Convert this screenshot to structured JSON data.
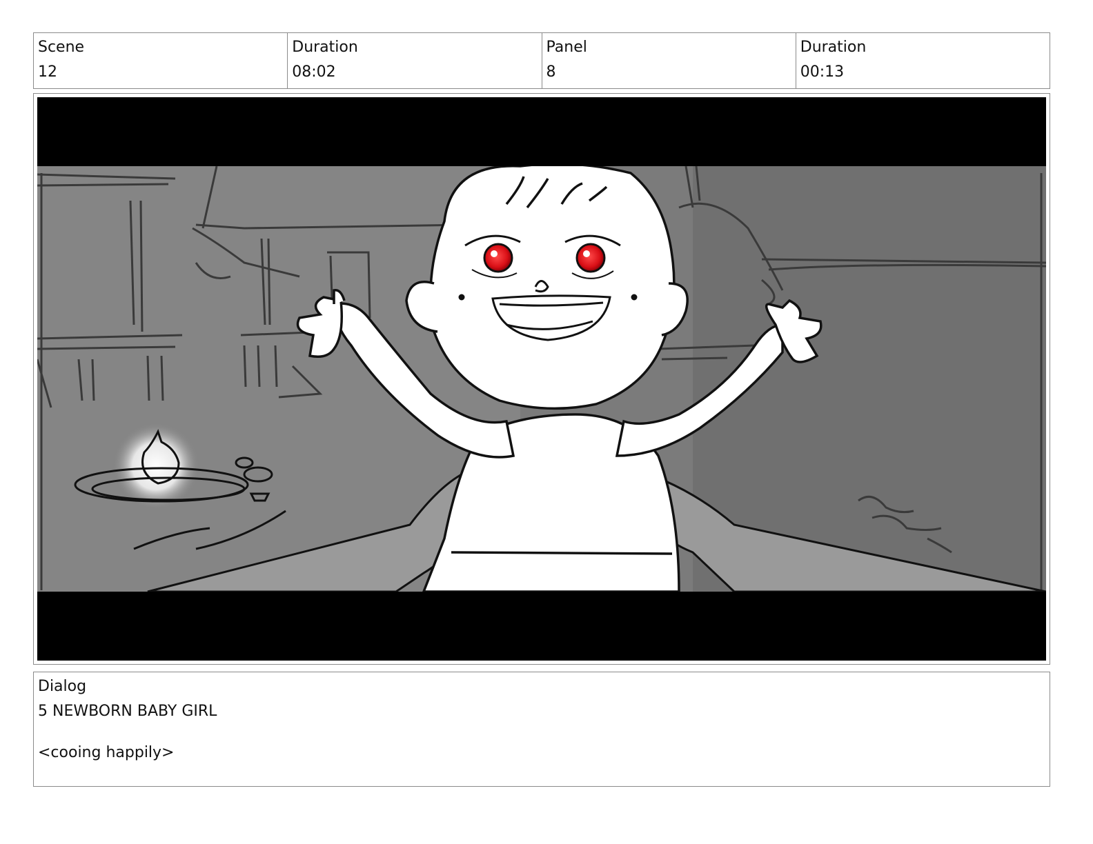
{
  "header": {
    "scene_label": "Scene",
    "scene_value": "12",
    "duration_label": "Duration",
    "duration_value": "08:02",
    "panel_label": "Panel",
    "panel_value": "8",
    "panel_duration_label": "Duration",
    "panel_duration_value": "00:13"
  },
  "panel_image": {
    "icon": "storyboard-sketch-baby-held-up",
    "letterbox_color": "#000000",
    "background_color": "#7a7a7a",
    "eye_color": "#e0141e"
  },
  "dialog": {
    "label": "Dialog",
    "speaker": "5 NEWBORN BABY GIRL",
    "line": "<cooing happily>"
  }
}
